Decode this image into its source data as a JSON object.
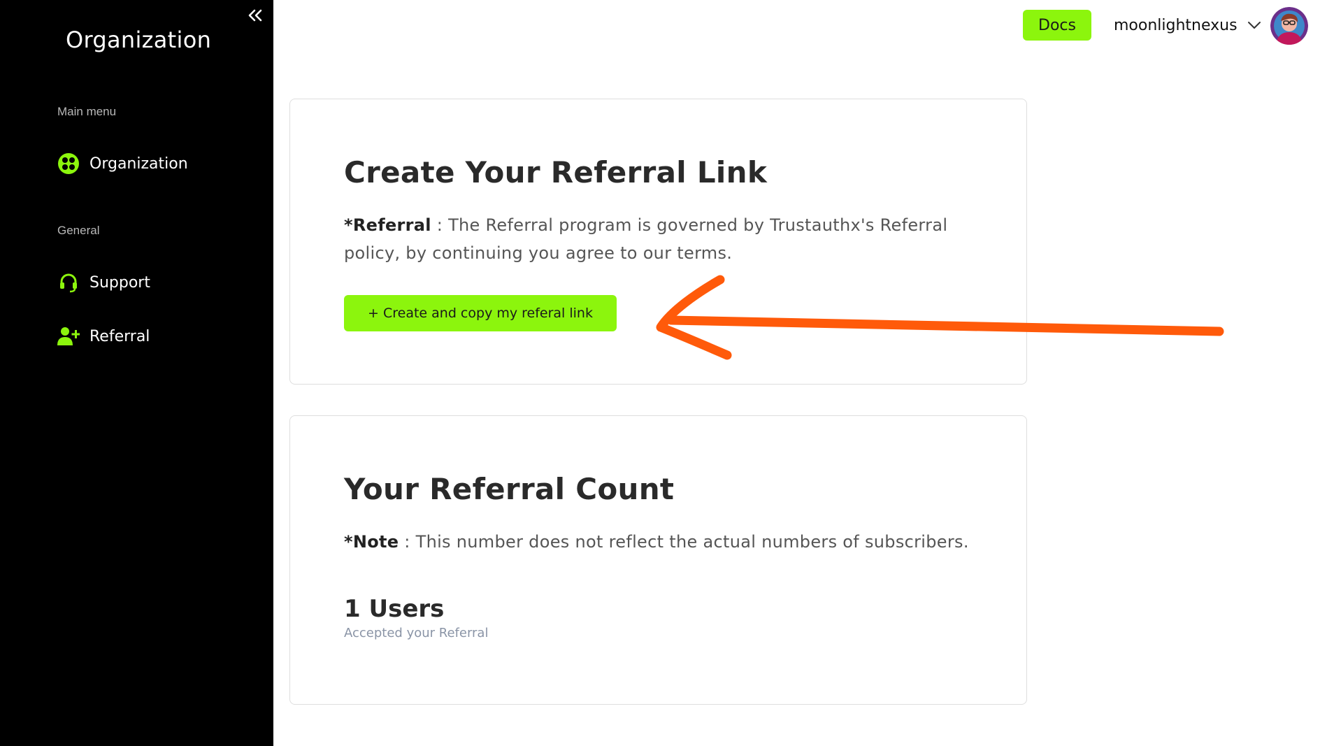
{
  "sidebar": {
    "title": "Organization",
    "collapse_icon": "double-chevron-left-icon",
    "sections": [
      {
        "label": "Main menu"
      },
      {
        "label": "General"
      }
    ],
    "items": [
      {
        "label": "Organization",
        "icon": "organization-icon"
      },
      {
        "label": "Support",
        "icon": "headset-icon"
      },
      {
        "label": "Referral",
        "icon": "user-plus-icon"
      }
    ]
  },
  "header": {
    "docs_label": "Docs",
    "username": "moonlightnexus",
    "dropdown_icon": "chevron-down-icon"
  },
  "referral_link_card": {
    "title": "Create Your Referral Link",
    "note_label": "*Referral",
    "note_text": " : The Referral program is governed by Trustauthx's Referral policy, by continuing you agree to our terms.",
    "button_label": "+ Create and copy my referal link"
  },
  "referral_count_card": {
    "title": "Your Referral Count",
    "note_label": "*Note",
    "note_text": " : This number does not reflect the actual numbers of subscribers.",
    "count_value": "1 Users",
    "count_caption": "Accepted your Referral"
  },
  "colors": {
    "accent": "#8cf50d",
    "sidebar_bg": "#000000",
    "annotation": "#ff5a0a"
  }
}
